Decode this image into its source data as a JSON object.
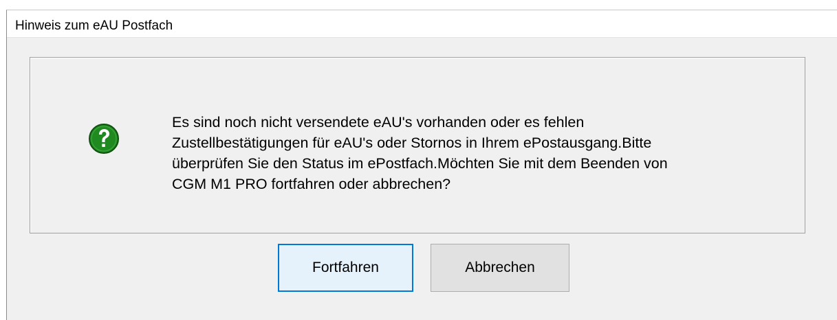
{
  "window": {
    "title": "Hinweis zum eAU Postfach"
  },
  "message": {
    "icon": "question-icon",
    "lines": [
      "Es sind noch nicht versendete eAU's vorhanden oder es fehlen",
      "Zustellbestätigungen für eAU's oder Stornos in Ihrem ePostausgang.Bitte",
      "überprüfen Sie den Status im ePostfach.Möchten Sie mit dem Beenden von",
      "CGM M1 PRO fortfahren oder abbrechen?"
    ]
  },
  "buttons": {
    "continue_label": "Fortfahren",
    "cancel_label": "Abbrechen"
  },
  "colors": {
    "icon_green": "#1f8a1f",
    "focus_blue": "#0078d7",
    "dialog_bg": "#f0f0f0"
  }
}
